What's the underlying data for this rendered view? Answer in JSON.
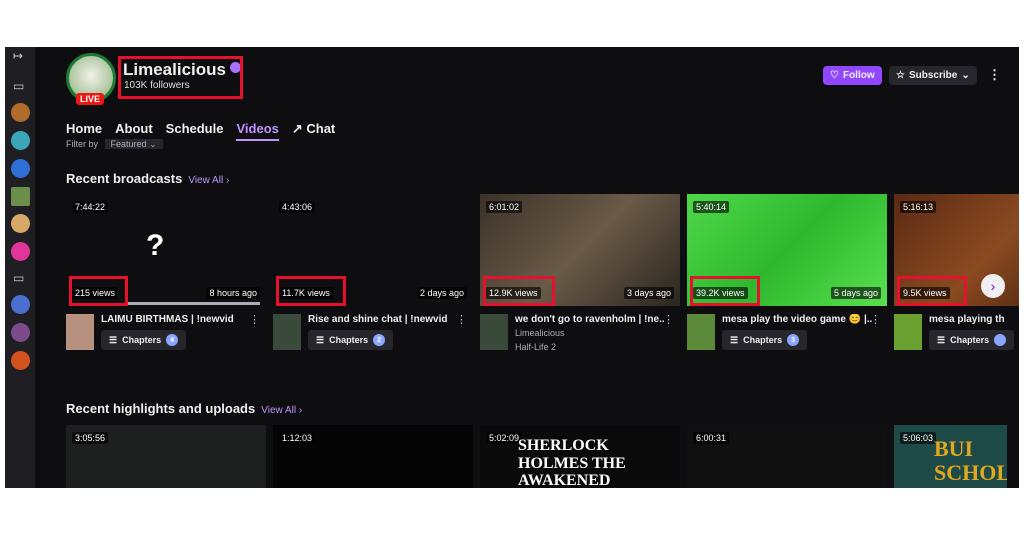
{
  "channel": {
    "name": "Limealicious",
    "followers": "103K followers",
    "live_badge": "LIVE"
  },
  "actions": {
    "follow": "Follow",
    "subscribe": "Subscribe"
  },
  "tabs": [
    {
      "label": "Home"
    },
    {
      "label": "About"
    },
    {
      "label": "Schedule"
    },
    {
      "label": "Videos",
      "active": true
    },
    {
      "label": "Chat"
    }
  ],
  "filter": {
    "label": "Filter by",
    "value": "Featured"
  },
  "recent_broadcasts": {
    "heading": "Recent broadcasts",
    "view_all": "View All ›",
    "items": [
      {
        "duration": "7:44:22",
        "views": "215 views",
        "ago": "8 hours ago",
        "title": "LAIMU BIRTHMAS | !newvid",
        "chapters_label": "Chapters",
        "chapters": "4"
      },
      {
        "duration": "4:43:06",
        "views": "11.7K views",
        "ago": "2 days ago",
        "title": "Rise and shine chat | !newvid",
        "chapters_label": "Chapters",
        "chapters": "2"
      },
      {
        "duration": "6:01:02",
        "views": "12.9K views",
        "ago": "3 days ago",
        "title": "we don't go to ravenholm | !ne...",
        "channel": "Limealicious",
        "game": "Half-Life 2"
      },
      {
        "duration": "5:40:14",
        "views": "39.2K views",
        "ago": "5 days ago",
        "title": "mesa play the video game 😊 |...",
        "chapters_label": "Chapters",
        "chapters": "3"
      },
      {
        "duration": "5:16:13",
        "views": "9.5K views",
        "ago": "",
        "title": "mesa playing th",
        "chapters_label": "Chapters",
        "chapters": ""
      }
    ]
  },
  "recent_highlights": {
    "heading": "Recent highlights and uploads",
    "view_all": "View All ›",
    "items": [
      {
        "duration": "3:05:56"
      },
      {
        "duration": "1:12:03"
      },
      {
        "duration": "5:02:09",
        "art_text": "SHERLOCK HOLMES THE AWAKENED"
      },
      {
        "duration": "6:00:31"
      },
      {
        "duration": "5:06:03",
        "art_text": "BUI SCHOLARSHI"
      }
    ]
  },
  "colors": {
    "accent": "#9147ff",
    "live": "#e91916",
    "annotation": "#e8112d",
    "background": "#0e0e10"
  }
}
